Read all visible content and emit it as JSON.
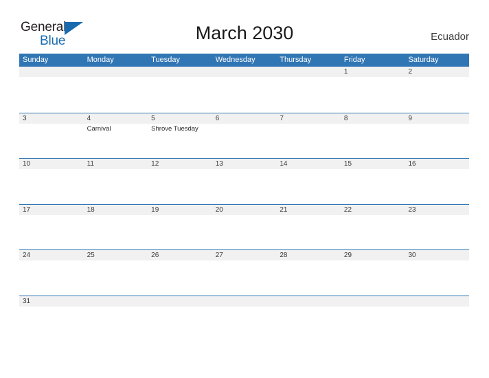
{
  "brand": {
    "name_part1": "General",
    "name_part2": "Blue",
    "triangle_icon": "triangle-icon",
    "accent_color": "#1a6ab0"
  },
  "header": {
    "title": "March 2030",
    "region": "Ecuador"
  },
  "colors": {
    "header_blue": "#3176b4",
    "row_gray": "#f1f1f1",
    "title_text": "#1a1a1a"
  },
  "calendar": {
    "weekdays": [
      "Sunday",
      "Monday",
      "Tuesday",
      "Wednesday",
      "Thursday",
      "Friday",
      "Saturday"
    ],
    "weeks": [
      [
        {
          "day": "",
          "event": ""
        },
        {
          "day": "",
          "event": ""
        },
        {
          "day": "",
          "event": ""
        },
        {
          "day": "",
          "event": ""
        },
        {
          "day": "",
          "event": ""
        },
        {
          "day": "1",
          "event": ""
        },
        {
          "day": "2",
          "event": ""
        }
      ],
      [
        {
          "day": "3",
          "event": ""
        },
        {
          "day": "4",
          "event": "Carnival"
        },
        {
          "day": "5",
          "event": "Shrove Tuesday"
        },
        {
          "day": "6",
          "event": ""
        },
        {
          "day": "7",
          "event": ""
        },
        {
          "day": "8",
          "event": ""
        },
        {
          "day": "9",
          "event": ""
        }
      ],
      [
        {
          "day": "10",
          "event": ""
        },
        {
          "day": "11",
          "event": ""
        },
        {
          "day": "12",
          "event": ""
        },
        {
          "day": "13",
          "event": ""
        },
        {
          "day": "14",
          "event": ""
        },
        {
          "day": "15",
          "event": ""
        },
        {
          "day": "16",
          "event": ""
        }
      ],
      [
        {
          "day": "17",
          "event": ""
        },
        {
          "day": "18",
          "event": ""
        },
        {
          "day": "19",
          "event": ""
        },
        {
          "day": "20",
          "event": ""
        },
        {
          "day": "21",
          "event": ""
        },
        {
          "day": "22",
          "event": ""
        },
        {
          "day": "23",
          "event": ""
        }
      ],
      [
        {
          "day": "24",
          "event": ""
        },
        {
          "day": "25",
          "event": ""
        },
        {
          "day": "26",
          "event": ""
        },
        {
          "day": "27",
          "event": ""
        },
        {
          "day": "28",
          "event": ""
        },
        {
          "day": "29",
          "event": ""
        },
        {
          "day": "30",
          "event": ""
        }
      ],
      [
        {
          "day": "31",
          "event": ""
        },
        {
          "day": "",
          "event": ""
        },
        {
          "day": "",
          "event": ""
        },
        {
          "day": "",
          "event": ""
        },
        {
          "day": "",
          "event": ""
        },
        {
          "day": "",
          "event": ""
        },
        {
          "day": "",
          "event": ""
        }
      ]
    ]
  }
}
